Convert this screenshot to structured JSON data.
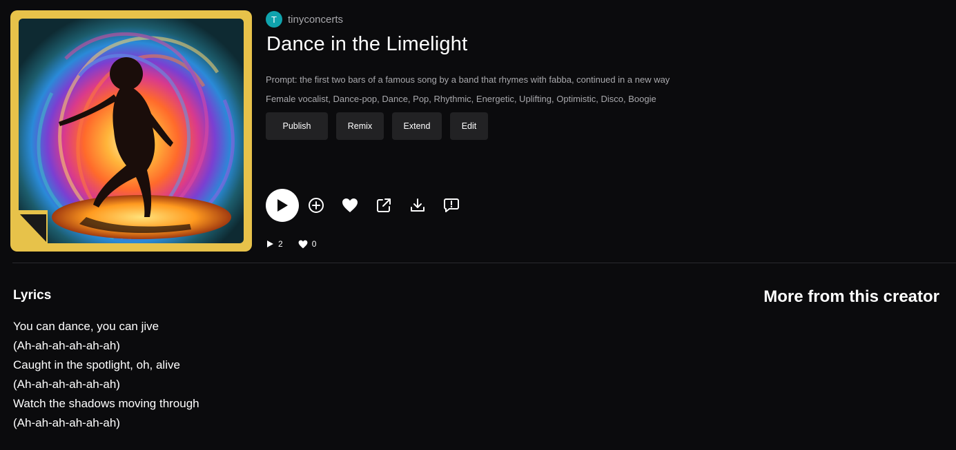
{
  "creator": {
    "avatar_letter": "T",
    "name": "tinyconcerts"
  },
  "song": {
    "title": "Dance in the Limelight",
    "prompt": "Prompt: the first two bars of a famous song by a band that rhymes with fabba, continued in a new way",
    "tags": "Female vocalist, Dance-pop, Dance, Pop, Rhythmic, Energetic, Uplifting, Optimistic, Disco, Boogie"
  },
  "actions": {
    "publish": "Publish",
    "remix": "Remix",
    "extend": "Extend",
    "edit": "Edit"
  },
  "player_icons": [
    "play-icon",
    "add-circle-icon",
    "heart-icon",
    "share-external-icon",
    "download-icon",
    "comment-icon"
  ],
  "stats": {
    "plays": "2",
    "likes": "0"
  },
  "lyrics": {
    "heading": "Lyrics",
    "lines": [
      "You can dance, you can jive",
      "(Ah-ah-ah-ah-ah-ah)",
      "Caught in the spotlight, oh, alive",
      "(Ah-ah-ah-ah-ah-ah)",
      "Watch the shadows moving through",
      "(Ah-ah-ah-ah-ah-ah)"
    ]
  },
  "more_from_creator": {
    "heading": "More from this creator"
  },
  "colors": {
    "background": "#0b0b0d",
    "avatar": "#0fa3ad",
    "button_bg": "#222224",
    "muted_text": "#a9a9ad",
    "cover_frame": "#e7c24a"
  }
}
